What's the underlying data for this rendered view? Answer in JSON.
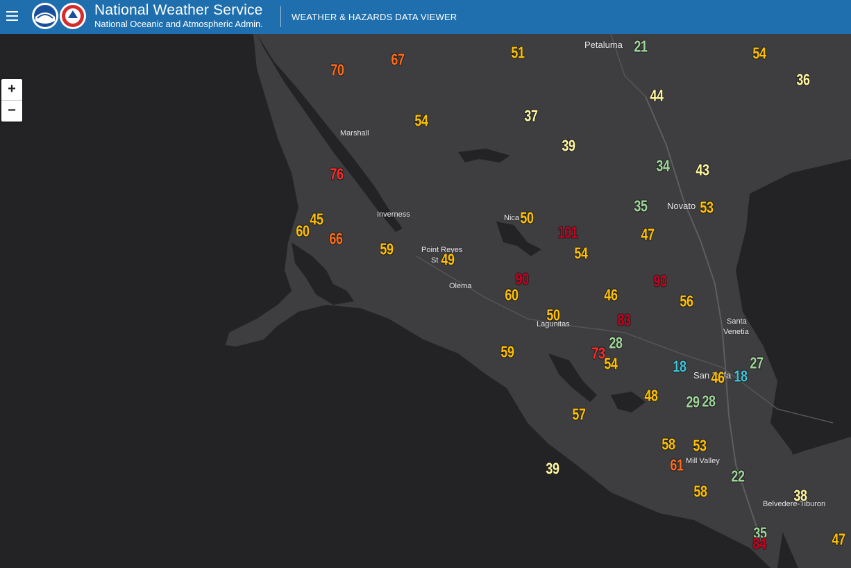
{
  "header": {
    "agency_name": "National Weather Service",
    "agency_sub": "National Oceanic and Atmospheric Admin.",
    "app_title": "WEATHER & HAZARDS DATA VIEWER"
  },
  "zoom": {
    "in_label": "+",
    "out_label": "−"
  },
  "colors": {
    "header_bg": "#1f6fae",
    "ocean": "#232326",
    "land": "#3e3e41",
    "cyan": "#3fc3d8",
    "green": "#9ed49a",
    "light_yellow": "#fff6a0",
    "yellow": "#ffc000",
    "orange": "#ff6a1a",
    "red": "#ff2a2a",
    "dark_red": "#c8001e"
  },
  "places": [
    {
      "id": "petaluma",
      "label": "Petaluma"
    },
    {
      "id": "marshall",
      "label": "Marshall"
    },
    {
      "id": "inverness",
      "label": "Inverness"
    },
    {
      "id": "nicasio",
      "label": "Nica"
    },
    {
      "id": "point-reyes",
      "label": "Point Reyes"
    },
    {
      "id": "point-reyes-2",
      "label": "St"
    },
    {
      "id": "olema",
      "label": "Olema"
    },
    {
      "id": "novato",
      "label": "Novato"
    },
    {
      "id": "lagunitas",
      "label": "Lagunitas"
    },
    {
      "id": "santa-venetia",
      "label": "Santa"
    },
    {
      "id": "santa-venetia-2",
      "label": "Venetia"
    },
    {
      "id": "san-rafael",
      "label": "San Rafa"
    },
    {
      "id": "mill-valley",
      "label": "Mill Valley"
    },
    {
      "id": "belvedere",
      "label": "Belvedere-Tiburon"
    }
  ],
  "observations": [
    {
      "value": "21",
      "color": "green"
    },
    {
      "value": "51",
      "color": "yellow"
    },
    {
      "value": "67",
      "color": "orange"
    },
    {
      "value": "70",
      "color": "orange"
    },
    {
      "value": "54",
      "color": "yellow"
    },
    {
      "value": "36",
      "color": "light_yellow"
    },
    {
      "value": "44",
      "color": "light_yellow"
    },
    {
      "value": "37",
      "color": "light_yellow"
    },
    {
      "value": "54",
      "color": "yellow"
    },
    {
      "value": "39",
      "color": "light_yellow"
    },
    {
      "value": "34",
      "color": "green"
    },
    {
      "value": "43",
      "color": "light_yellow"
    },
    {
      "value": "76",
      "color": "red"
    },
    {
      "value": "35",
      "color": "green"
    },
    {
      "value": "53",
      "color": "yellow"
    },
    {
      "value": "45",
      "color": "yellow"
    },
    {
      "value": "60",
      "color": "yellow"
    },
    {
      "value": "66",
      "color": "orange"
    },
    {
      "value": "50",
      "color": "yellow"
    },
    {
      "value": "101",
      "color": "dark_red"
    },
    {
      "value": "47",
      "color": "yellow"
    },
    {
      "value": "59",
      "color": "yellow"
    },
    {
      "value": "49",
      "color": "yellow"
    },
    {
      "value": "54",
      "color": "yellow"
    },
    {
      "value": "90",
      "color": "dark_red"
    },
    {
      "value": "90",
      "color": "dark_red"
    },
    {
      "value": "60",
      "color": "yellow"
    },
    {
      "value": "46",
      "color": "yellow"
    },
    {
      "value": "56",
      "color": "yellow"
    },
    {
      "value": "50",
      "color": "yellow"
    },
    {
      "value": "83",
      "color": "dark_red"
    },
    {
      "value": "28",
      "color": "green"
    },
    {
      "value": "59",
      "color": "yellow"
    },
    {
      "value": "73",
      "color": "red"
    },
    {
      "value": "54",
      "color": "yellow"
    },
    {
      "value": "18",
      "color": "cyan"
    },
    {
      "value": "27",
      "color": "green"
    },
    {
      "value": "46",
      "color": "yellow"
    },
    {
      "value": "18",
      "color": "cyan"
    },
    {
      "value": "48",
      "color": "yellow"
    },
    {
      "value": "29",
      "color": "green"
    },
    {
      "value": "28",
      "color": "green"
    },
    {
      "value": "57",
      "color": "yellow"
    },
    {
      "value": "58",
      "color": "yellow"
    },
    {
      "value": "53",
      "color": "yellow"
    },
    {
      "value": "61",
      "color": "orange"
    },
    {
      "value": "39",
      "color": "light_yellow"
    },
    {
      "value": "22",
      "color": "green"
    },
    {
      "value": "58",
      "color": "yellow"
    },
    {
      "value": "38",
      "color": "light_yellow"
    },
    {
      "value": "35",
      "color": "green"
    },
    {
      "value": "84",
      "color": "dark_red"
    },
    {
      "value": "47",
      "color": "yellow"
    }
  ]
}
